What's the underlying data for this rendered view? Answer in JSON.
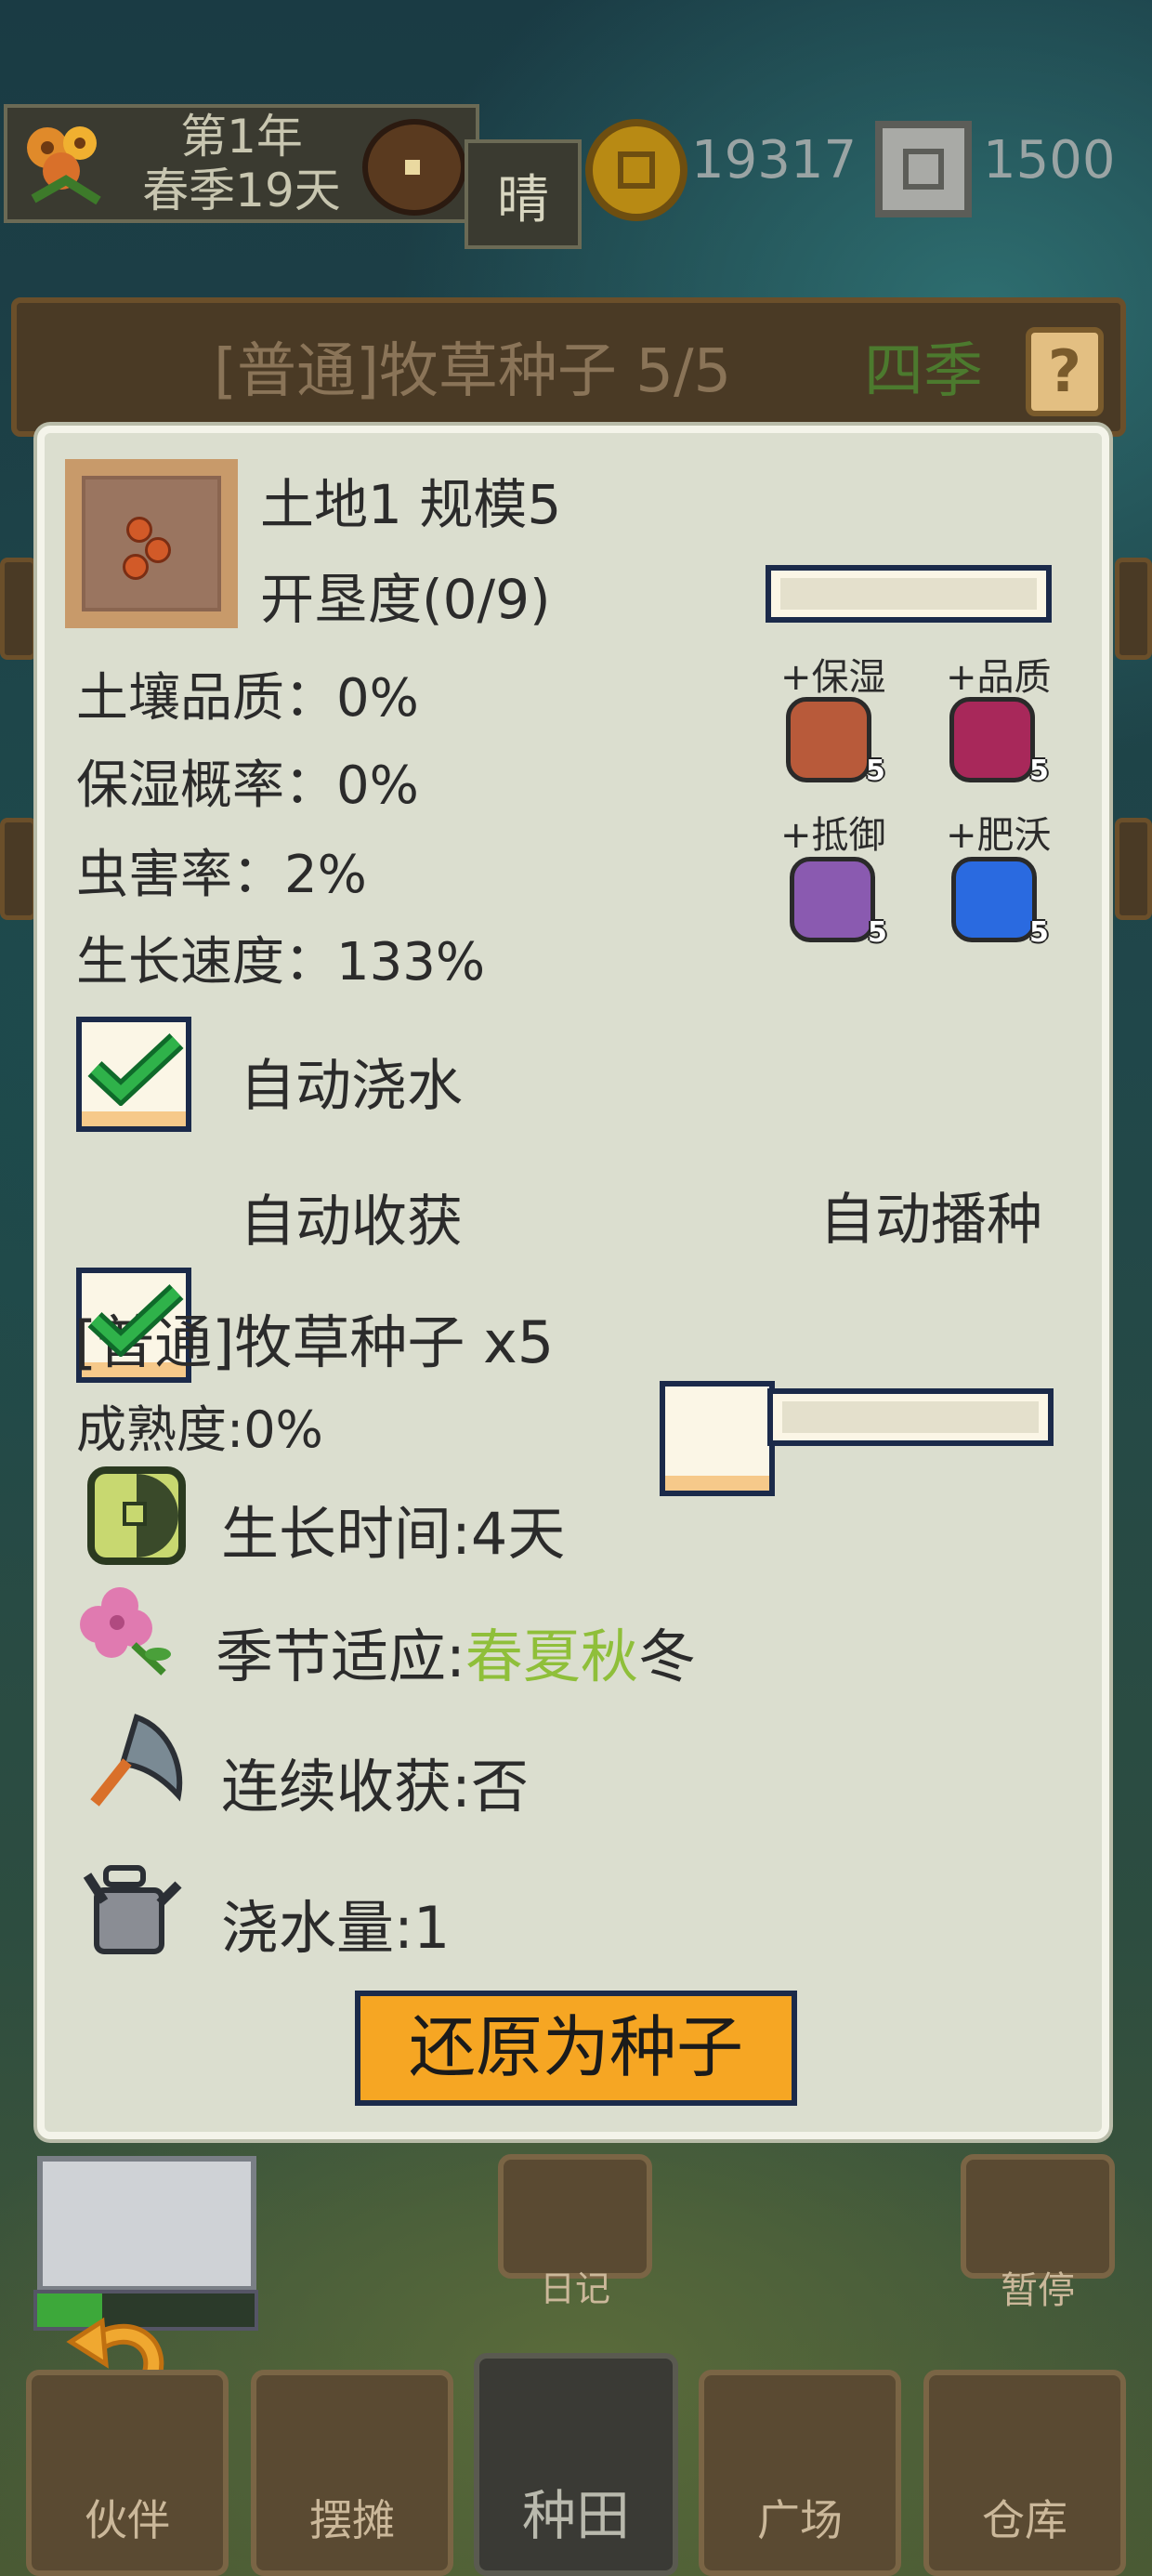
{
  "status_bar": {
    "year": "第1年",
    "season_day": "春季19天",
    "weather": "晴",
    "coins": "19317",
    "chips": "1500"
  },
  "behind_row": {
    "seed_title": "[普通]牧草种子 5/5",
    "season_label": "四季",
    "help": "?"
  },
  "panel": {
    "land_title": "土地1 规模5",
    "cultivation": "开垦度(0/9)",
    "stats": [
      "土壤品质：0%",
      "保湿概率：0%",
      "虫害率：2%",
      "生长速度：133%"
    ],
    "fertilizers": [
      {
        "label": "+保湿",
        "count": "5",
        "icon": "moisture-gem-icon",
        "color": "#b85a3a"
      },
      {
        "label": "+品质",
        "count": "5",
        "icon": "quality-gem-icon",
        "color": "#a8285a"
      },
      {
        "label": "+抵御",
        "count": "5",
        "icon": "defense-gem-icon",
        "color": "#8a5ab0"
      },
      {
        "label": "+肥沃",
        "count": "5",
        "icon": "fertile-gem-icon",
        "color": "#2a6ae0"
      }
    ],
    "auto_water": {
      "label": "自动浇水",
      "checked": true
    },
    "auto_harvest": {
      "label": "自动收获",
      "checked": true
    },
    "auto_sow": {
      "label": "自动播种",
      "checked": false
    },
    "crop_title": "[普通]牧草种子 x5",
    "maturity": "成熟度:0%",
    "growth_time": "生长时间:4天",
    "season_prefix": "季节适应:",
    "season_spring": "春",
    "season_summer": "夏",
    "season_autumn": "秋",
    "season_winter": "冬",
    "season_active_color": "#8fbf3a",
    "continuous": "连续收获:否",
    "water_amount": "浇水量:1",
    "restore_button": "还原为种子"
  },
  "bottom": {
    "diary": "日记",
    "pause": "暂停",
    "nav": [
      "伙伴",
      "摆摊",
      "种田",
      "广场",
      "仓库"
    ]
  }
}
